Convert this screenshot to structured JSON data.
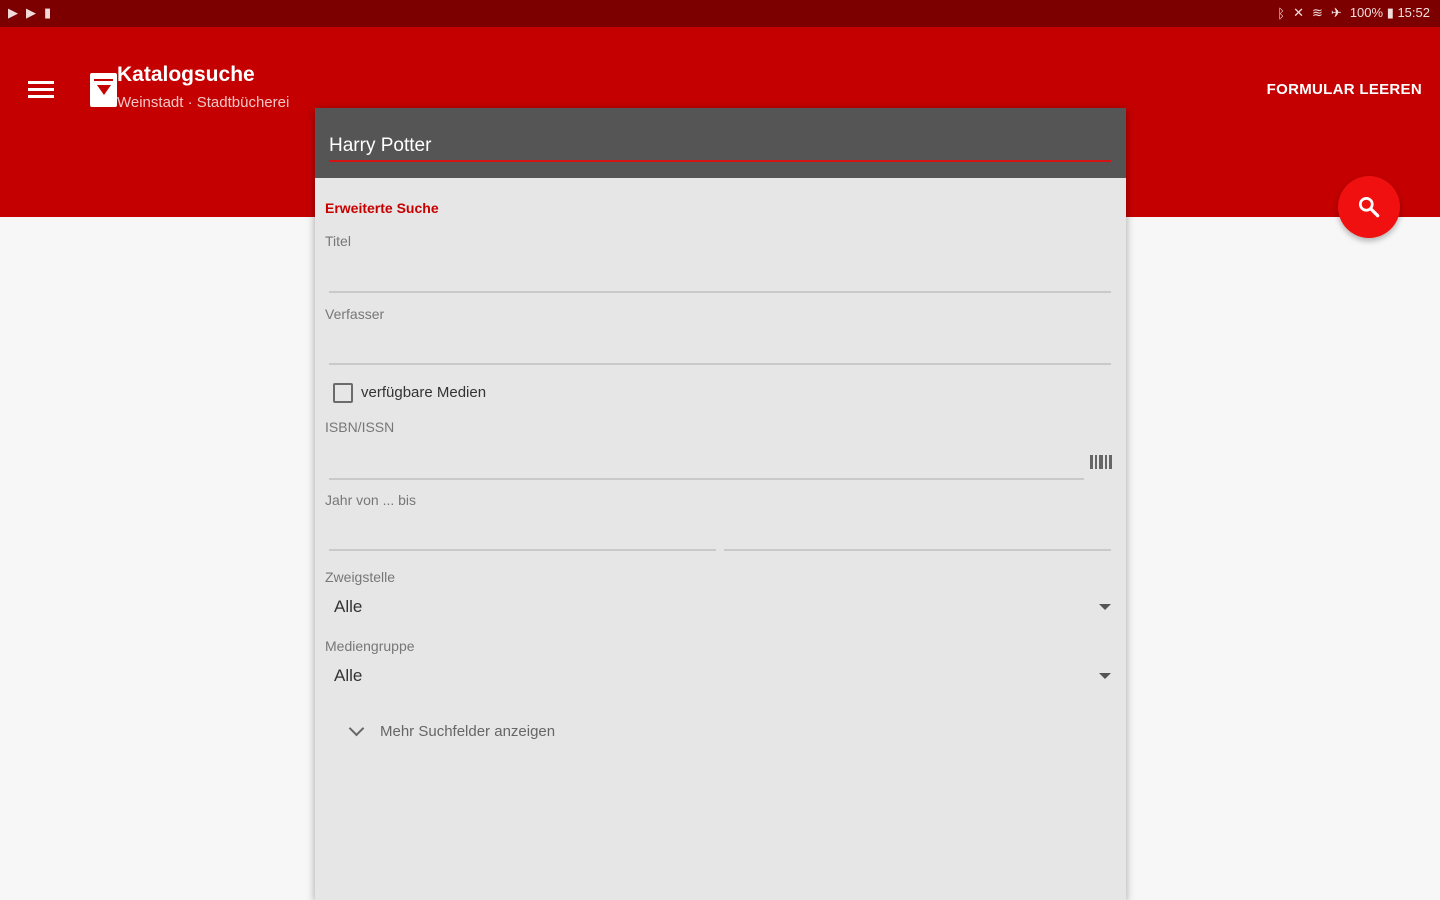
{
  "status_bar": {
    "left_icons": [
      "play-store-icon",
      "play-store-icon",
      "battery-saver-icon"
    ],
    "right_text": "100% ▮ 15:52"
  },
  "app_bar": {
    "title": "Katalogsuche",
    "subtitle": "Weinstadt · Stadtbücherei",
    "clear_button_label": "FORMULAR LEEREN",
    "accent_color": "#c40000"
  },
  "search": {
    "query_value": "Harry Potter"
  },
  "form": {
    "section_title": "Erweiterte Suche",
    "title_label": "Titel",
    "title_value": "",
    "author_label": "Verfasser",
    "author_value": "",
    "available_checkbox_label": "verfügbare Medien",
    "available_checked": false,
    "isbn_label": "ISBN/ISSN",
    "isbn_value": "",
    "year_label": "Jahr von ... bis",
    "year_from": "",
    "year_to": "",
    "branch_label": "Zweigstelle",
    "branch_selected": "Alle",
    "mediagroup_label": "Mediengruppe",
    "mediagroup_selected": "Alle",
    "more_fields_label": "Mehr Suchfelder anzeigen"
  }
}
